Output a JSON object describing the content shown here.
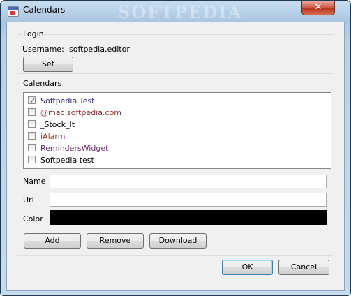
{
  "window": {
    "title": "Calendars",
    "watermark": "SOFTPEDIA",
    "close_glyph": "✕"
  },
  "login": {
    "group_label": "Login",
    "username_label": "Username:",
    "username_value": "softpedia.editor",
    "set_button": "Set"
  },
  "calendars": {
    "group_label": "Calendars",
    "items": [
      {
        "label": "Softpedia Test",
        "checked": true,
        "color": "#3b2a7a"
      },
      {
        "label": "@mac.softpedia.com",
        "checked": false,
        "color": "#8b2a2a"
      },
      {
        "label": "_Stock_It",
        "checked": false,
        "color": "#000000"
      },
      {
        "label": "iAlarm",
        "checked": false,
        "color": "#a23a2a"
      },
      {
        "label": "RemindersWidget",
        "checked": false,
        "color": "#6a2a6a"
      },
      {
        "label": "Softpedia test",
        "checked": false,
        "color": "#000000"
      }
    ],
    "check_glyph": "✓",
    "name_label": "Name",
    "name_value": "",
    "url_label": "Url",
    "url_value": "",
    "color_label": "Color",
    "color_value": "#000000",
    "add_button": "Add",
    "remove_button": "Remove",
    "download_button": "Download"
  },
  "footer": {
    "ok_button": "OK",
    "cancel_button": "Cancel"
  }
}
